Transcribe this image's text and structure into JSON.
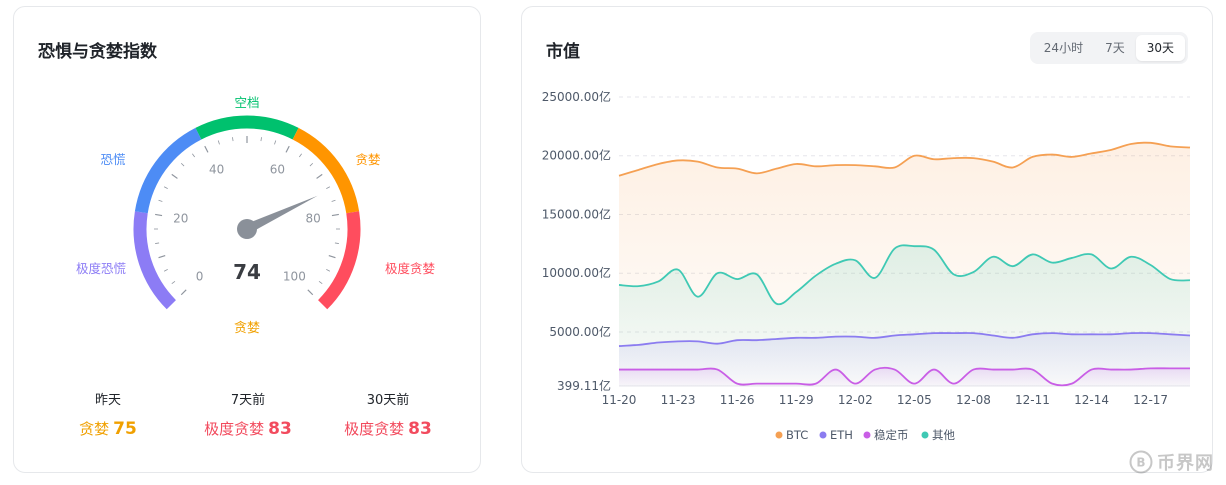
{
  "fear_greed": {
    "title": "恐惧与贪婪指数",
    "value": "74",
    "segments": [
      {
        "label": "极度恐慌",
        "color": "#8c7cf5"
      },
      {
        "label": "恐慌",
        "color": "#4d8cf5"
      },
      {
        "label": "空档",
        "color": "#00c16e"
      },
      {
        "label": "贪婪",
        "color": "#ff9500"
      },
      {
        "label": "极度贪婪",
        "color": "#ff4d5e"
      }
    ],
    "ticks": [
      "0",
      "20",
      "40",
      "60",
      "80",
      "100"
    ],
    "status_label": "贪婪",
    "status_color": "#f0a000",
    "history": [
      {
        "label": "昨天",
        "status": "贪婪",
        "value": "75",
        "color": "#f0a000"
      },
      {
        "label": "7天前",
        "status": "极度贪婪",
        "value": "83",
        "color": "#f24b5e"
      },
      {
        "label": "30天前",
        "status": "极度贪婪",
        "value": "83",
        "color": "#f24b5e"
      }
    ]
  },
  "market_cap": {
    "title": "市值",
    "tabs": [
      {
        "label": "24小时",
        "active": false
      },
      {
        "label": "7天",
        "active": false
      },
      {
        "label": "30天",
        "active": true
      }
    ]
  },
  "watermark": {
    "text": "币界网"
  },
  "chart_data": {
    "type": "area",
    "title": "市值",
    "y_ticks": [
      "25000.00亿",
      "20000.00亿",
      "15000.00亿",
      "10000.00亿",
      "5000.00亿",
      "399.11亿"
    ],
    "y_tick_values": [
      25000,
      20000,
      15000,
      10000,
      5000,
      399.11
    ],
    "x_ticks": [
      "11-20",
      "11-23",
      "11-26",
      "11-29",
      "12-02",
      "12-05",
      "12-08",
      "12-11",
      "12-14",
      "12-17"
    ],
    "ylim": [
      399.11,
      25000
    ],
    "grid": true,
    "legend_position": "bottom",
    "x": [
      "11-20",
      "11-21",
      "11-22",
      "11-23",
      "11-24",
      "11-25",
      "11-26",
      "11-27",
      "11-28",
      "11-29",
      "11-30",
      "12-01",
      "12-02",
      "12-03",
      "12-04",
      "12-05",
      "12-06",
      "12-07",
      "12-08",
      "12-09",
      "12-10",
      "12-11",
      "12-12",
      "12-13",
      "12-14",
      "12-15",
      "12-16",
      "12-17",
      "12-18",
      "12-19"
    ],
    "series": [
      {
        "name": "BTC",
        "color": "#f5a053",
        "values": [
          18300,
          18800,
          19300,
          19600,
          19500,
          19000,
          18900,
          18500,
          18900,
          19300,
          19100,
          19200,
          19200,
          19100,
          19000,
          20000,
          19700,
          19800,
          19800,
          19500,
          19000,
          19900,
          20100,
          19900,
          20200,
          20500,
          21000,
          21100,
          20800,
          20700
        ]
      },
      {
        "name": "ETH",
        "color": "#8b7cf0",
        "values": [
          3800,
          3900,
          4100,
          4200,
          4200,
          4000,
          4300,
          4300,
          4400,
          4500,
          4500,
          4600,
          4600,
          4500,
          4700,
          4800,
          4900,
          4900,
          4900,
          4700,
          4500,
          4800,
          4900,
          4800,
          4800,
          4800,
          4900,
          4900,
          4800,
          4700
        ]
      },
      {
        "name": "稳定币",
        "color": "#c95ee6",
        "values": [
          1800,
          1800,
          1800,
          1800,
          1800,
          1800,
          600,
          600,
          600,
          600,
          600,
          1800,
          600,
          1800,
          1800,
          600,
          1800,
          600,
          1800,
          1800,
          1800,
          1800,
          600,
          600,
          1800,
          1800,
          1800,
          1900,
          1900,
          1900
        ]
      },
      {
        "name": "其他",
        "color": "#3fc9b4",
        "values": [
          9000,
          8900,
          9300,
          10300,
          8000,
          10000,
          9500,
          9900,
          7400,
          8400,
          9800,
          10800,
          11100,
          9600,
          12100,
          12300,
          12000,
          9900,
          10100,
          11400,
          10600,
          11600,
          10900,
          11300,
          11600,
          10400,
          11400,
          10700,
          9500,
          9400
        ]
      }
    ]
  }
}
